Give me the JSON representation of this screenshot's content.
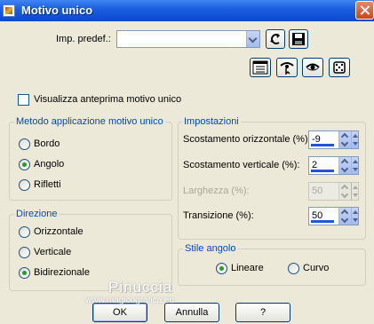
{
  "window": {
    "title": "Motivo unico"
  },
  "preset": {
    "label": "Imp. predef.:",
    "value": ""
  },
  "preview": {
    "label": "Visualizza anteprima motivo unico",
    "checked": false
  },
  "metodo": {
    "title": "Metodo applicazione motivo unico",
    "options": [
      {
        "label": "Bordo",
        "checked": false
      },
      {
        "label": "Angolo",
        "checked": true
      },
      {
        "label": "Rifletti",
        "checked": false
      }
    ]
  },
  "direzione": {
    "title": "Direzione",
    "options": [
      {
        "label": "Orizzontale",
        "checked": false
      },
      {
        "label": "Verticale",
        "checked": false
      },
      {
        "label": "Bidirezionale",
        "checked": true
      }
    ]
  },
  "impostazioni": {
    "title": "Impostazioni",
    "fields": [
      {
        "label": "Scostamento orizzontale (%):",
        "value": "-9",
        "enabled": true
      },
      {
        "label": "Scostamento verticale (%):",
        "value": "2",
        "enabled": true
      },
      {
        "label": "Larghezza (%):",
        "value": "50",
        "enabled": false
      },
      {
        "label": "Transizione (%):",
        "value": "50",
        "enabled": true
      }
    ]
  },
  "stile": {
    "title": "Stile angolo",
    "options": [
      {
        "label": "Lineare",
        "checked": true
      },
      {
        "label": "Curvo",
        "checked": false
      }
    ]
  },
  "buttons": {
    "ok": "OK",
    "cancel": "Annulla",
    "help": "?"
  },
  "watermark": {
    "name": "Pinuccia",
    "url": "www.magicografica.eu"
  },
  "icons": {
    "preset_reset": "reset-arrow-icon",
    "preset_save": "save-disk-icon",
    "tool1": "window-list-icon",
    "tool2": "eye-pointer-icon",
    "tool3": "eye-icon",
    "tool4": "dice-icon"
  }
}
